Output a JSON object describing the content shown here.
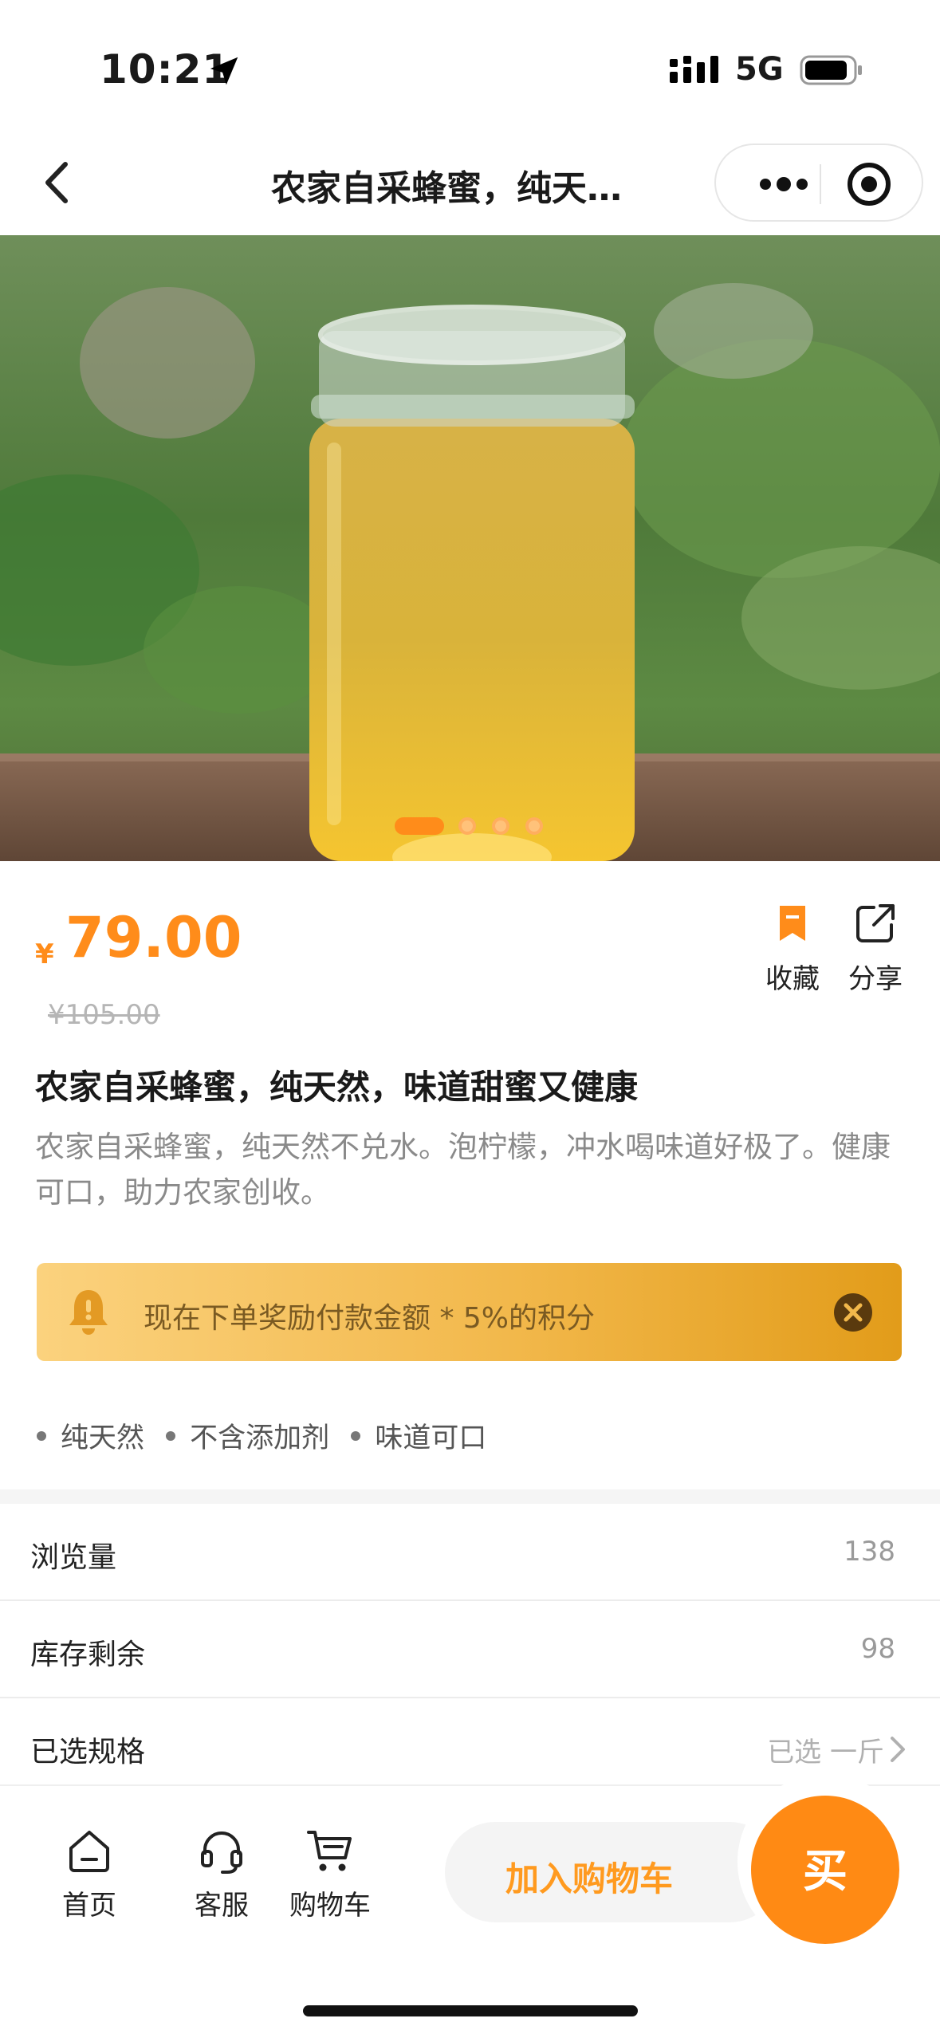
{
  "status_bar": {
    "time": "10:21",
    "network": "5G"
  },
  "nav": {
    "title": "农家自采蜂蜜，纯天…"
  },
  "gallery": {
    "image_count": 4,
    "active_index": 0
  },
  "product": {
    "currency": "¥",
    "price": "79.00",
    "original_price": "¥105.00",
    "favorite_label": "收藏",
    "share_label": "分享",
    "title": "农家自采蜂蜜，纯天然，味道甜蜜又健康",
    "description": "农家自采蜂蜜，纯天然不兑水。泡柠檬，冲水喝味道好极了。健康可口，助力农家创收。"
  },
  "reward_banner": {
    "text": "现在下单奖励付款金额 * 5%的积分"
  },
  "tags": [
    "纯天然",
    "不含添加剂",
    "味道可口"
  ],
  "info_rows": [
    {
      "label": "浏览量",
      "value": "138"
    },
    {
      "label": "库存剩余",
      "value": "98"
    },
    {
      "label": "已选规格",
      "value": "已选 一斤"
    }
  ],
  "bottom_bar": {
    "tabs": [
      {
        "label": "首页",
        "icon": "home-icon"
      },
      {
        "label": "客服",
        "icon": "headset-icon"
      },
      {
        "label": "购物车",
        "icon": "cart-icon"
      }
    ],
    "add_to_cart": "加入购物车",
    "buy": "买"
  },
  "colors": {
    "accent": "#ff8c1a",
    "banner_start": "#fbd27e",
    "banner_end": "#e29c1a"
  }
}
